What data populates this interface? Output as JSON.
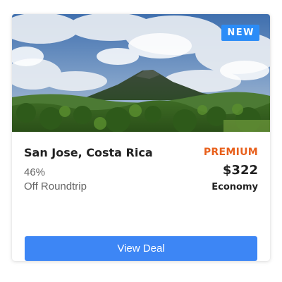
{
  "deal": {
    "badge": "NEW",
    "destination": "San Jose, Costa Rica",
    "discount_percent": "46%",
    "discount_label": "Off Roundtrip",
    "tier": "PREMIUM",
    "price": "$322",
    "cabin": "Economy",
    "cta_label": "View Deal"
  },
  "colors": {
    "badge_bg": "#2b8cf7",
    "tier_text": "#e8601c",
    "cta_bg": "#3d86f5"
  }
}
